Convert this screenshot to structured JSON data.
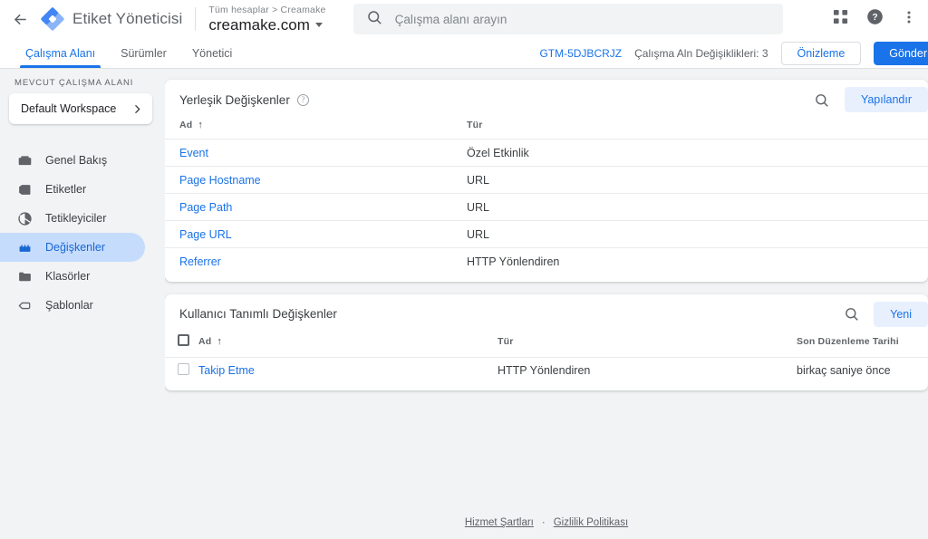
{
  "topbar": {
    "back_icon": "arrow-left-icon",
    "logo_icon": "tag-manager-logo",
    "product_name": "Etiket Yöneticisi",
    "account_breadcrumb": "Tüm hesaplar > Creamake",
    "account_name": "creamake.com",
    "search": {
      "icon": "search-icon",
      "placeholder": "Çalışma alanı arayın",
      "value": ""
    },
    "apps_icon": "apps-grid-icon",
    "help_icon": "help-circle-icon",
    "more_icon": "more-vertical-icon"
  },
  "tabbar": {
    "tabs": [
      {
        "label": "Çalışma Alanı",
        "active": true
      },
      {
        "label": "Sürümler",
        "active": false
      },
      {
        "label": "Yönetici",
        "active": false
      }
    ],
    "container_id": "GTM-5DJBCRJZ",
    "workspace_changes": "Çalışma Aln Değişiklikleri: 3",
    "preview_label": "Önizleme",
    "submit_label": "Gönder"
  },
  "sidebar": {
    "current_workspace_label": "MEVCUT ÇALIŞMA ALANI",
    "workspace_name": "Default Workspace",
    "workspace_arrow_icon": "chevron-right-icon",
    "items": [
      {
        "label": "Genel Bakış",
        "icon": "overview-icon",
        "active": false
      },
      {
        "label": "Etiketler",
        "icon": "tag-icon",
        "active": false
      },
      {
        "label": "Tetikleyiciler",
        "icon": "trigger-icon",
        "active": false
      },
      {
        "label": "Değişkenler",
        "icon": "variables-icon",
        "active": true
      },
      {
        "label": "Klasörler",
        "icon": "folder-icon",
        "active": false
      },
      {
        "label": "Şablonlar",
        "icon": "template-icon",
        "active": false
      }
    ]
  },
  "builtin_card": {
    "title": "Yerleşik Değişkenler",
    "help_icon": "help-circle-icon",
    "search_icon": "search-icon",
    "configure_label": "Yapılandır",
    "columns": {
      "name": "Ad",
      "type": "Tür"
    },
    "sort_arrow": "↑",
    "rows": [
      {
        "name": "Event",
        "type": "Özel Etkinlik"
      },
      {
        "name": "Page Hostname",
        "type": "URL"
      },
      {
        "name": "Page Path",
        "type": "URL"
      },
      {
        "name": "Page URL",
        "type": "URL"
      },
      {
        "name": "Referrer",
        "type": "HTTP Yönlendiren"
      }
    ]
  },
  "user_card": {
    "title": "Kullanıcı Tanımlı Değişkenler",
    "search_icon": "search-icon",
    "new_label": "Yeni",
    "columns": {
      "name": "Ad",
      "type": "Tür",
      "modified": "Son Düzenleme Tarihi"
    },
    "sort_arrow": "↑",
    "rows": [
      {
        "name": "Takip Etme",
        "type": "HTTP Yönlendiren",
        "modified": "birkaç saniye önce"
      }
    ]
  },
  "footer": {
    "terms": "Hizmet Şartları",
    "separator": "·",
    "privacy": "Gizlilik Politikası"
  },
  "colors": {
    "accent_blue": "#1a73e8",
    "active_pill": "#c6dcfd",
    "tonal_blue_bg": "#e8f0fe",
    "page_bg": "#f1f3f4",
    "text_primary": "#3c4043",
    "text_secondary": "#5f6368"
  }
}
